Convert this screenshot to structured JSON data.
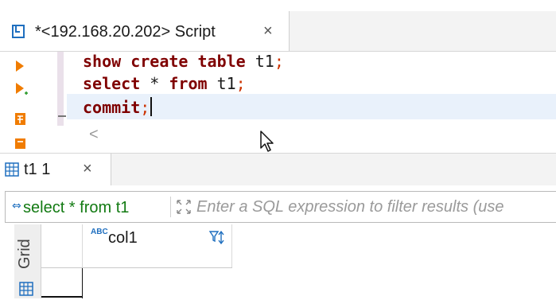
{
  "editor_tab": {
    "label": "*<192.168.20.202> Script",
    "close": "×"
  },
  "code_lines": [
    {
      "keyword1": "show create table",
      "ident": " t1",
      "punct": ";"
    },
    {
      "keyword1": "select",
      "middle": " * ",
      "keyword2": "from",
      "ident": " t1",
      "punct": ";"
    },
    {
      "keyword1": "commit",
      "punct": ";"
    }
  ],
  "scroll_arrow": "<",
  "results_tab": {
    "label": "t1 1",
    "close": "×"
  },
  "filter": {
    "query": "select * from t1",
    "placeholder": "Enter a SQL expression to filter results (use"
  },
  "side_rail": {
    "label": "Grid"
  },
  "grid": {
    "type_badge": "ABC",
    "columns": [
      "col1"
    ]
  },
  "colors": {
    "keyword": "#7f0000",
    "punctuation": "#cc3300",
    "filter_query": "#127a12",
    "icon_orange": "#f07c00",
    "icon_blue": "#1f6fbf",
    "current_line": "#e9f1fb"
  },
  "icons": [
    "script-icon",
    "execute-statement-icon",
    "execute-script-icon",
    "explain-plan-icon",
    "load-plan-icon",
    "grid-icon",
    "sql-icon",
    "expand-editor-icon",
    "sort-filter-icon",
    "pointer-cursor-icon"
  ]
}
